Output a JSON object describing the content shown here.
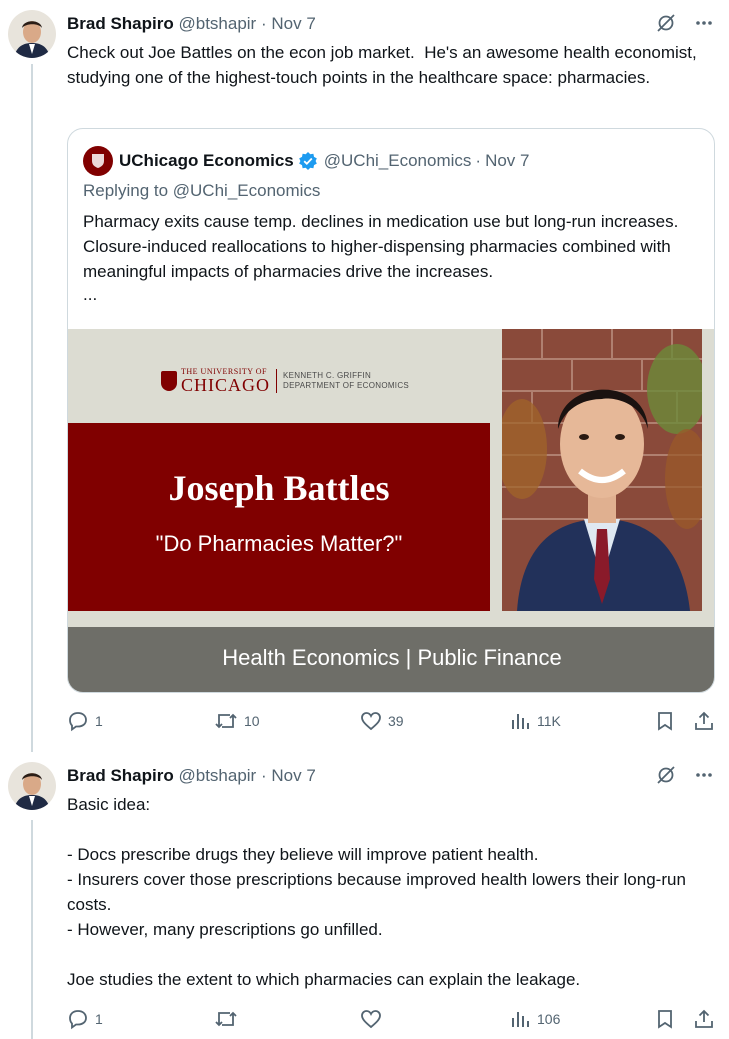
{
  "tweets": [
    {
      "author_name": "Brad Shapiro",
      "handle": "@btshapir",
      "separator": "·",
      "date": "Nov 7",
      "text": "Check out Joe Battles on the econ job market.  He's an awesome health economist, studying one of the highest-touch points in the healthcare space: pharmacies.",
      "quote": {
        "author_name": "UChicago Economics",
        "handle": "@UChi_Economics",
        "separator": "·",
        "date": "Nov 7",
        "replying_to": "Replying to @UChi_Economics",
        "text": "Pharmacy exits cause temp. declines in medication use but long-run increases. Closure-induced reallocations to higher-dispensing pharmacies combined with meaningful impacts of pharmacies drive the increases.",
        "ellipsis": "...",
        "card": {
          "university_small": "THE UNIVERSITY OF",
          "university_big": "CHICAGO",
          "dept_line1": "KENNETH C. GRIFFIN",
          "dept_line2": "DEPARTMENT OF ECONOMICS",
          "title": "Joseph Battles",
          "subtitle": "\"Do Pharmacies Matter?\"",
          "footer": "Health Economics | Public Finance"
        }
      },
      "actions": {
        "replies": "1",
        "retweets": "10",
        "likes": "39",
        "views": "11K"
      }
    },
    {
      "author_name": "Brad Shapiro",
      "handle": "@btshapir",
      "separator": "·",
      "date": "Nov 7",
      "text": "Basic idea:\n\n- Docs prescribe drugs they believe will improve patient health.\n- Insurers cover those prescriptions because improved health lowers their long-run costs.\n- However, many prescriptions go unfilled.\n\nJoe studies the extent to which pharmacies can explain the leakage.",
      "actions": {
        "replies": "1",
        "retweets": "",
        "likes": "",
        "views": "106"
      }
    }
  ],
  "colors": {
    "accent": "#1d9bf0",
    "muted": "#536471",
    "uchicago_maroon": "#800000",
    "border": "#cfd9de"
  },
  "icons": [
    "grok-icon",
    "more-icon",
    "reply-icon",
    "retweet-icon",
    "like-icon",
    "views-icon",
    "bookmark-icon",
    "share-icon",
    "verified-icon"
  ]
}
